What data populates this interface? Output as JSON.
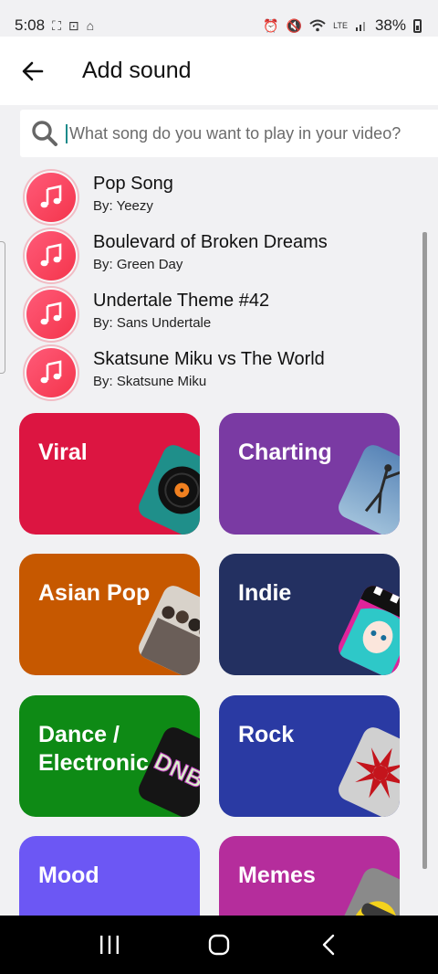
{
  "status": {
    "time": "5:08",
    "battery": "38%",
    "left_icons": [
      "screenshot-icon",
      "screen-record-icon",
      "home-app-icon"
    ],
    "right_icons": [
      "alarm-icon",
      "mute-icon",
      "wifi-icon",
      "volte-icon",
      "signal-icon",
      "battery-icon"
    ]
  },
  "header": {
    "title": "Add sound"
  },
  "search": {
    "placeholder": "What song do you want to play in your video?",
    "value": ""
  },
  "songs": [
    {
      "title": "Pop Song",
      "artist": "By: Yeezy"
    },
    {
      "title": "Boulevard of Broken Dreams",
      "artist": "By: Green Day"
    },
    {
      "title": "Undertale Theme #42",
      "artist": "By: Sans Undertale"
    },
    {
      "title": "Skatsune Miku vs The World",
      "artist": "By: Skatsune Miku"
    }
  ],
  "genres": [
    {
      "label": "Viral",
      "color": "#dc1541",
      "art": "vinyl-record-art"
    },
    {
      "label": "Charting",
      "color": "#7a3aa3",
      "art": "dancer-photo-art"
    },
    {
      "label": "Asian Pop",
      "color": "#c65800",
      "art": "group-photo-art"
    },
    {
      "label": "Indie",
      "color": "#233061",
      "art": "anime-character-art"
    },
    {
      "label": "Dance / Electronic",
      "color": "#0e8a15",
      "art": "dnb-text-art"
    },
    {
      "label": "Rock",
      "color": "#2a3aa3",
      "art": "rock-logo-art"
    },
    {
      "label": "Mood",
      "color": "#6c57f4",
      "art": ""
    },
    {
      "label": "Memes",
      "color": "#b52d9c",
      "art": "yellow-character-art"
    }
  ],
  "nav": {
    "buttons": [
      "recents-icon",
      "home-icon",
      "back-icon"
    ]
  }
}
